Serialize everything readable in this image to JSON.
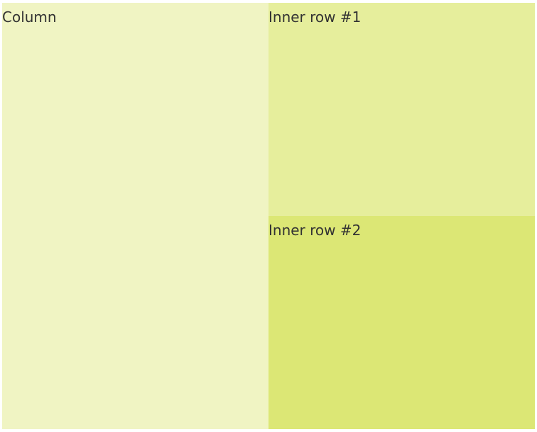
{
  "column": {
    "label": "Column",
    "color": "#f0f4c3"
  },
  "inner_rows": [
    {
      "label": "Inner row #1",
      "color": "#e6ee9c"
    },
    {
      "label": "Inner row #2",
      "color": "#dce775"
    }
  ]
}
